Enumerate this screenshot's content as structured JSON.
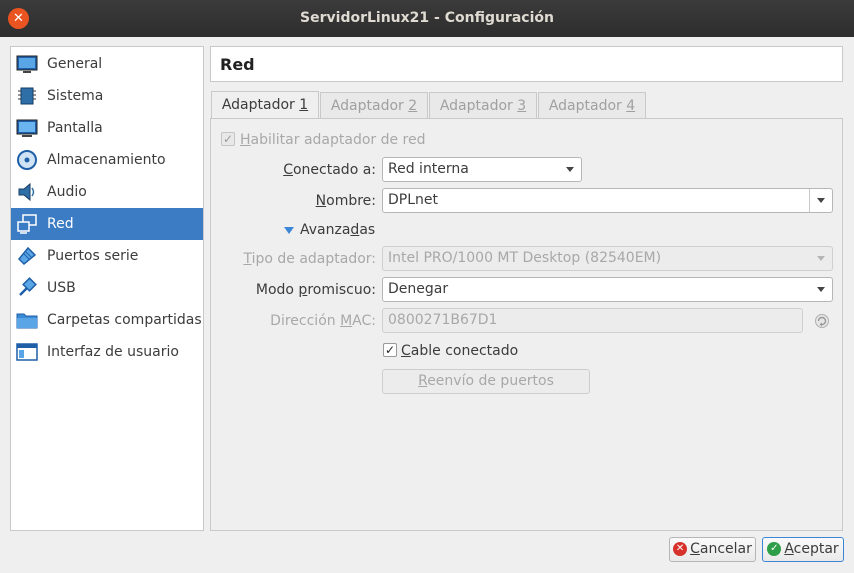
{
  "window": {
    "title": "ServidorLinux21 - Configuración",
    "close_glyph": "✕"
  },
  "sidebar": {
    "items": [
      {
        "label": "General",
        "icon": "general-icon"
      },
      {
        "label": "Sistema",
        "icon": "chip-icon"
      },
      {
        "label": "Pantalla",
        "icon": "monitor-icon"
      },
      {
        "label": "Almacenamiento",
        "icon": "disk-icon"
      },
      {
        "label": "Audio",
        "icon": "speaker-icon"
      },
      {
        "label": "Red",
        "icon": "network-icon",
        "selected": true
      },
      {
        "label": "Puertos serie",
        "icon": "serial-port-icon"
      },
      {
        "label": "USB",
        "icon": "usb-icon"
      },
      {
        "label": "Carpetas compartidas",
        "icon": "folder-icon"
      },
      {
        "label": "Interfaz de usuario",
        "icon": "window-icon"
      }
    ]
  },
  "header": {
    "title": "Red"
  },
  "tabs": [
    {
      "prefix": "Adaptador ",
      "num": "1",
      "active": true
    },
    {
      "prefix": "Adaptador ",
      "num": "2",
      "active": false
    },
    {
      "prefix": "Adaptador ",
      "num": "3",
      "active": false
    },
    {
      "prefix": "Adaptador ",
      "num": "4",
      "active": false
    }
  ],
  "form": {
    "enable": {
      "mn": "H",
      "rest": "abilitar adaptador de red",
      "checked": true
    },
    "attached": {
      "mn": "C",
      "rest": "onectado a:",
      "value": "Red interna"
    },
    "name": {
      "mn": "N",
      "rest": "ombre:",
      "value": "DPLnet"
    },
    "advanced": {
      "pre": "Avanza",
      "mn": "d",
      "post": "as"
    },
    "adapter_type": {
      "mn": "T",
      "rest": "ipo de adaptador:",
      "value": "Intel PRO/1000 MT Desktop (82540EM)"
    },
    "promisc": {
      "pre": "Modo ",
      "mn": "p",
      "post": "romiscuo:",
      "value": "Denegar"
    },
    "mac": {
      "pre": "Dirección ",
      "mn": "M",
      "post": "AC:",
      "value": "0800271B67D1"
    },
    "cable": {
      "mn": "C",
      "rest": "able conectado",
      "checked": true
    },
    "port_forward": {
      "mn": "R",
      "rest": "eenvío de puertos"
    }
  },
  "buttons": {
    "cancel": {
      "mn": "C",
      "rest": "ancelar"
    },
    "ok": {
      "mn": "A",
      "rest": "ceptar"
    }
  },
  "colors": {
    "accent": "#3b7cc4",
    "close": "#e95420",
    "cancel_icon": "#d6312b",
    "ok_icon": "#2e9f48"
  }
}
